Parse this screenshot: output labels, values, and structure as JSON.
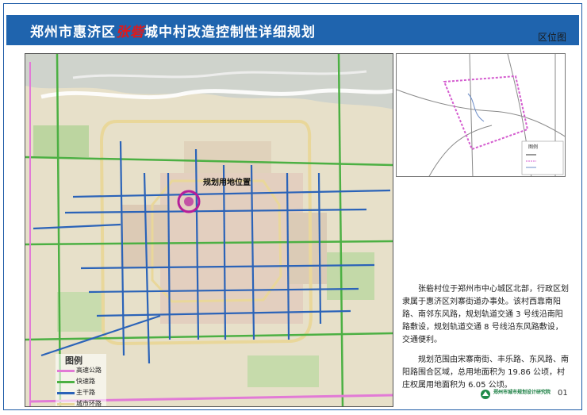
{
  "header": {
    "title_pre": "郑州市惠济区",
    "title_highlight": "张砦",
    "title_post": "城中村改造控制性详细规划",
    "subtitle": "区位图"
  },
  "main_map": {
    "location_label": "规划用地位置"
  },
  "legend": {
    "title": "图例",
    "items": [
      {
        "label": "高速公路",
        "color": "#e27ad6"
      },
      {
        "label": "快速路",
        "color": "#4cb043"
      },
      {
        "label": "主干路",
        "color": "#2b63b8"
      },
      {
        "label": "城市环路",
        "color": "#e9d79a"
      }
    ]
  },
  "inset_map": {
    "legend_title": "图例"
  },
  "description": {
    "paragraph_1": "张砦村位于郑州市中心城区北部，行政区划隶属于惠济区刘寨街道办事处。该村西靠南阳路、南邻东风路，规划轨道交通 3 号线沿南阳路敷设，规划轨道交通 8 号线沿东风路敷设，交通便利。",
    "paragraph_2": "规划范围由宋寨南街、丰乐路、东风路、南阳路围合区域，总用地面积为 19.86 公顷，村庄权属用地面积为 6.05 公顷。"
  },
  "footer": {
    "org_name": "郑州市城市规划设计研究院",
    "page_number": "01"
  },
  "colors": {
    "header_bg": "#1f64ae",
    "highlight": "#e0191b",
    "expressway": "#e27ad6",
    "fast_road": "#4cb043",
    "arterial": "#2b63b8",
    "ring_road": "#e9d79a",
    "site_marker": "#b51e9a"
  }
}
